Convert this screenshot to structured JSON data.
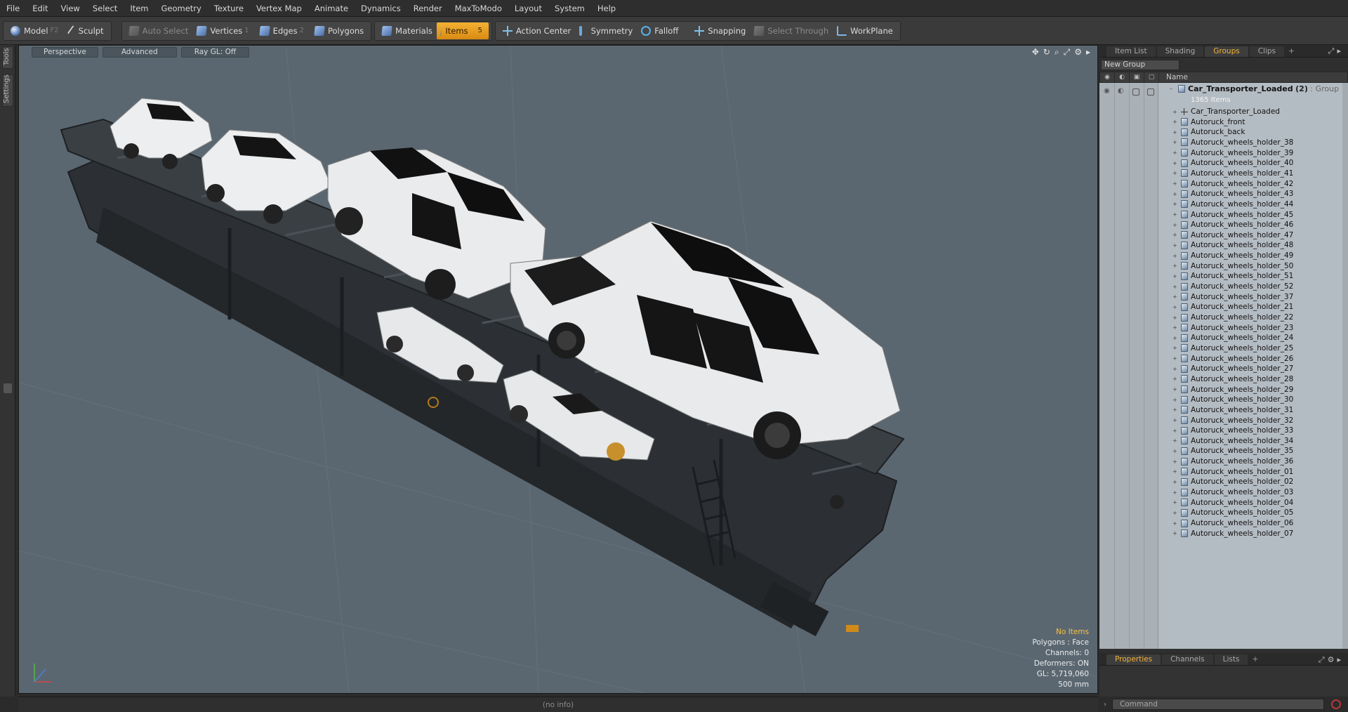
{
  "menu": [
    "File",
    "Edit",
    "View",
    "Select",
    "Item",
    "Geometry",
    "Texture",
    "Vertex Map",
    "Animate",
    "Dynamics",
    "Render",
    "MaxToModo",
    "Layout",
    "System",
    "Help"
  ],
  "toolbar": {
    "model": "Model",
    "model_key": "F2",
    "sculpt": "Sculpt",
    "auto_select": "Auto Select",
    "vertices": "Vertices",
    "vertices_key": "1",
    "edges": "Edges",
    "edges_key": "2",
    "polygons": "Polygons",
    "materials": "Materials",
    "items": "Items",
    "items_key": "5",
    "action_center": "Action Center",
    "symmetry": "Symmetry",
    "falloff": "Falloff",
    "snapping": "Snapping",
    "select_through": "Select Through",
    "workplane": "WorkPlane",
    "accent_color": "#f0a628"
  },
  "left_tabs": {
    "tools": "Tools",
    "settings": "Settings"
  },
  "viewport": {
    "tabs": [
      "Perspective",
      "Advanced",
      "Ray GL: Off"
    ],
    "icons": [
      "move-icon",
      "orbit-icon",
      "zoom-icon",
      "maximize-icon",
      "gear-icon",
      "arrow-right-icon"
    ],
    "info": {
      "selection": "No Items",
      "polygons": "Polygons : Face",
      "channels": "Channels: 0",
      "deformers": "Deformers: ON",
      "gl": "GL: 5,719,060",
      "scale": "500 mm"
    },
    "background": "#5b6770"
  },
  "status": {
    "text": "(no info)"
  },
  "right_panel": {
    "tabs": [
      "Item List",
      "Shading",
      "Groups",
      "Clips"
    ],
    "active_tab": "Groups",
    "new_group": "New Group",
    "column_name": "Name",
    "root": {
      "name": "Car_Transporter_Loaded",
      "count": "(2)",
      "type": ": Group",
      "items": "1365 Items"
    },
    "items": [
      "Car_Transporter_Loaded",
      "Autoruck_front",
      "Autoruck_back",
      "Autoruck_wheels_holder_38",
      "Autoruck_wheels_holder_39",
      "Autoruck_wheels_holder_40",
      "Autoruck_wheels_holder_41",
      "Autoruck_wheels_holder_42",
      "Autoruck_wheels_holder_43",
      "Autoruck_wheels_holder_44",
      "Autoruck_wheels_holder_45",
      "Autoruck_wheels_holder_46",
      "Autoruck_wheels_holder_47",
      "Autoruck_wheels_holder_48",
      "Autoruck_wheels_holder_49",
      "Autoruck_wheels_holder_50",
      "Autoruck_wheels_holder_51",
      "Autoruck_wheels_holder_52",
      "Autoruck_wheels_holder_37",
      "Autoruck_wheels_holder_21",
      "Autoruck_wheels_holder_22",
      "Autoruck_wheels_holder_23",
      "Autoruck_wheels_holder_24",
      "Autoruck_wheels_holder_25",
      "Autoruck_wheels_holder_26",
      "Autoruck_wheels_holder_27",
      "Autoruck_wheels_holder_28",
      "Autoruck_wheels_holder_29",
      "Autoruck_wheels_holder_30",
      "Autoruck_wheels_holder_31",
      "Autoruck_wheels_holder_32",
      "Autoruck_wheels_holder_33",
      "Autoruck_wheels_holder_34",
      "Autoruck_wheels_holder_35",
      "Autoruck_wheels_holder_36",
      "Autoruck_wheels_holder_01",
      "Autoruck_wheels_holder_02",
      "Autoruck_wheels_holder_03",
      "Autoruck_wheels_holder_04",
      "Autoruck_wheels_holder_05",
      "Autoruck_wheels_holder_06",
      "Autoruck_wheels_holder_07"
    ],
    "bottom_tabs": [
      "Properties",
      "Channels",
      "Lists"
    ],
    "bottom_active": "Properties",
    "command_placeholder": "Command"
  }
}
